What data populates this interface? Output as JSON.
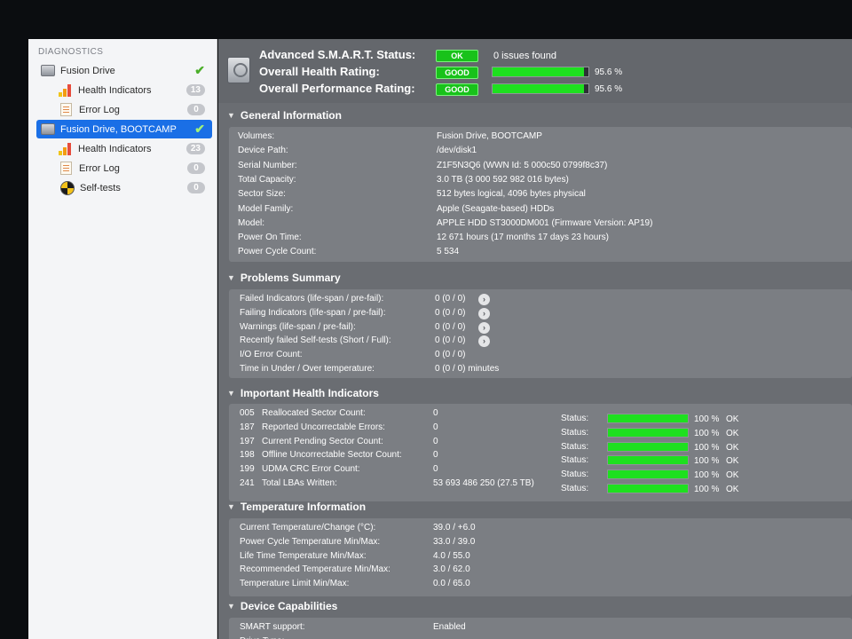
{
  "sidebar": {
    "heading": "DIAGNOSTICS",
    "items": [
      {
        "label": "Fusion Drive",
        "check": "✔"
      },
      {
        "label": "Health Indicators",
        "badge": "13"
      },
      {
        "label": "Error Log",
        "badge": "0"
      },
      {
        "label": "Fusion Drive, BOOTCAMP",
        "check": "✔"
      },
      {
        "label": "Health Indicators",
        "badge": "23"
      },
      {
        "label": "Error Log",
        "badge": "0"
      },
      {
        "label": "Self-tests",
        "badge": "0"
      }
    ]
  },
  "status": {
    "smart_label": "Advanced S.M.A.R.T. Status:",
    "smart_value": "OK",
    "smart_text": "0 issues found",
    "health_label": "Overall Health Rating:",
    "health_value": "GOOD",
    "health_percent": 95.6,
    "health_pct_text": "95.6 %",
    "perf_label": "Overall Performance Rating:",
    "perf_value": "GOOD",
    "perf_percent": 95.6,
    "perf_pct_text": "95.6 %"
  },
  "sections": {
    "general": {
      "title": "General Information",
      "rows": [
        {
          "label": "Volumes:",
          "value": "Fusion Drive, BOOTCAMP"
        },
        {
          "label": "Device Path:",
          "value": "/dev/disk1"
        },
        {
          "label": "Serial Number:",
          "value": "Z1F5N3Q6 (WWN Id: 5 000c50 0799f8c37)"
        },
        {
          "label": "Total Capacity:",
          "value": "3.0 TB (3 000 592 982 016 bytes)"
        },
        {
          "label": "Sector Size:",
          "value": "512 bytes logical, 4096 bytes physical"
        },
        {
          "label": "Model Family:",
          "value": "Apple (Seagate-based) HDDs"
        },
        {
          "label": "Model:",
          "value": "APPLE HDD ST3000DM001  (Firmware Version: AP19)"
        },
        {
          "label": "Power On Time:",
          "value": "12 671 hours (17 months 17 days 23 hours)"
        },
        {
          "label": "Power Cycle Count:",
          "value": "5 534"
        }
      ]
    },
    "problems": {
      "title": "Problems Summary",
      "rows": [
        {
          "label": "Failed Indicators (life-span / pre-fail):",
          "value": "0 (0 / 0)",
          "arrow": "›"
        },
        {
          "label": "Failing Indicators (life-span / pre-fail):",
          "value": "0 (0 / 0)",
          "arrow": "›"
        },
        {
          "label": "Warnings (life-span / pre-fail):",
          "value": "0 (0 / 0)",
          "arrow": "›"
        },
        {
          "label": "Recently failed Self-tests (Short / Full):",
          "value": "0 (0 / 0)",
          "arrow": "›"
        },
        {
          "label": "I/O Error Count:",
          "value": "0 (0 / 0)"
        },
        {
          "label": "Time in Under / Over temperature:",
          "value": "0 (0 / 0)   minutes"
        }
      ]
    },
    "health": {
      "title": "Important Health Indicators",
      "rows": [
        {
          "id": "005",
          "label": "Reallocated Sector Count:",
          "value": "0",
          "status_label": "Status:",
          "percent": 100,
          "pct_text": "100 %",
          "state": "OK"
        },
        {
          "id": "187",
          "label": "Reported Uncorrectable Errors:",
          "value": "0",
          "status_label": "Status:",
          "percent": 100,
          "pct_text": "100 %",
          "state": "OK"
        },
        {
          "id": "197",
          "label": "Current Pending Sector Count:",
          "value": "0",
          "status_label": "Status:",
          "percent": 100,
          "pct_text": "100 %",
          "state": "OK"
        },
        {
          "id": "198",
          "label": "Offline Uncorrectable Sector Count:",
          "value": "0",
          "status_label": "Status:",
          "percent": 100,
          "pct_text": "100 %",
          "state": "OK"
        },
        {
          "id": "199",
          "label": "UDMA CRC Error Count:",
          "value": "0",
          "status_label": "Status:",
          "percent": 100,
          "pct_text": "100 %",
          "state": "OK"
        },
        {
          "id": "241",
          "label": "Total LBAs Written:",
          "value": "53 693 486 250 (27.5 TB)",
          "status_label": "Status:",
          "percent": 100,
          "pct_text": "100 %",
          "state": "OK"
        }
      ]
    },
    "temperature": {
      "title": "Temperature Information",
      "rows": [
        {
          "label": "Current Temperature/Change (°C):",
          "value": "39.0 / +6.0"
        },
        {
          "label": "Power Cycle Temperature Min/Max:",
          "value": "33.0 / 39.0"
        },
        {
          "label": "Life Time Temperature Min/Max:",
          "value": "4.0   / 55.0"
        },
        {
          "label": "Recommended Temperature Min/Max:",
          "value": "3.0   / 62.0"
        },
        {
          "label": "Temperature Limit Min/Max:",
          "value": "0.0   / 65.0"
        }
      ]
    },
    "capabilities": {
      "title": "Device Capabilities",
      "rows": [
        {
          "label": "SMART support:",
          "value": "Enabled"
        },
        {
          "label": "Drive Type:",
          "value": ""
        }
      ]
    }
  },
  "colors": {
    "accent": "#1a6fe6",
    "good": "#1ee01f",
    "panel": "#6a6d72"
  }
}
